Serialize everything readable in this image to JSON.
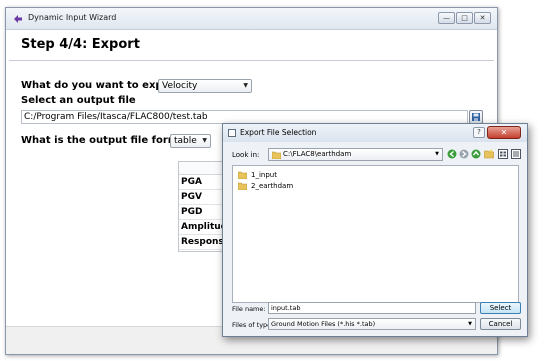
{
  "window": {
    "title": "Dynamic Input Wizard",
    "minimize": "—",
    "maximize": "□",
    "close": "✕"
  },
  "wizard": {
    "step_title": "Step 4/4: Export",
    "export_question": "What do you want to export?",
    "export_value": "Velocity",
    "output_file_label": "Select an output file",
    "output_file_path": "C:/Program Files/Itasca/FLAC800/test.tab",
    "format_question": "What is the output file format?",
    "format_value": "table",
    "rows": [
      "PGA",
      "PGV",
      "PGD",
      "Amplitude",
      "Response"
    ]
  },
  "dialog": {
    "title": "Export File Selection",
    "help": "?",
    "close": "✕",
    "look_in_label": "Look in:",
    "look_in_value": "C:\\FLAC8\\earthdam",
    "files": [
      "1_input",
      "2_earthdam"
    ],
    "file_name_label": "File name:",
    "file_name_value": "input.tab",
    "files_of_type_label": "Files of type:",
    "files_of_type_value": "Ground Motion Files (*.his *.tab)",
    "select_button": "Select",
    "cancel_button": "Cancel"
  },
  "colors": {
    "folder": "#e8c25a",
    "nav_green": "#3a9d3a",
    "accent_blue": "#3c7fb1"
  }
}
